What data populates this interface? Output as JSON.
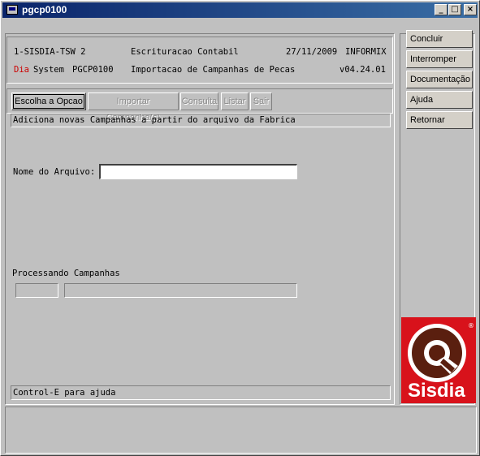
{
  "window": {
    "title": "pgcp0100"
  },
  "titlebar_buttons": {
    "minimize": "_",
    "maximize": "□",
    "close": "×"
  },
  "header": {
    "line1": {
      "system": "1-SISDIA-TSW 2",
      "module": "Escrituracao Contabil",
      "date": "27/11/2009",
      "db": "INFORMIX"
    },
    "line2": {
      "dia": "Dia",
      "system": "System",
      "program": "PGCP0100",
      "title": "Importacao de Campanhas de Pecas",
      "version": "v04.24.01"
    }
  },
  "menu": [
    {
      "label": "Escolha a Opcao",
      "state": "active"
    },
    {
      "label": "Importar Campanha(s)",
      "state": "disabled"
    },
    {
      "label": "Consulta",
      "state": "disabled"
    },
    {
      "label": "Listar",
      "state": "disabled"
    },
    {
      "label": "Sair",
      "state": "disabled"
    }
  ],
  "description": "Adiciona novas Campanhas a partir do arquivo da Fabrica",
  "form": {
    "file_label": "Nome do Arquivo:",
    "file_value": "",
    "processing_label": "Processando Campanhas"
  },
  "status": "Control-E para ajuda",
  "side_buttons": [
    "Concluir",
    "Interromper",
    "Documentação",
    "Ajuda",
    "Retornar"
  ],
  "logo": {
    "text": "Sisdia",
    "mark": "®",
    "bg_color": "#d8121b"
  },
  "colors": {
    "titlebar_start": "#0a246a",
    "titlebar_end": "#3a6ea5",
    "dia_red": "#cc0000",
    "face": "#c0c0c0"
  }
}
